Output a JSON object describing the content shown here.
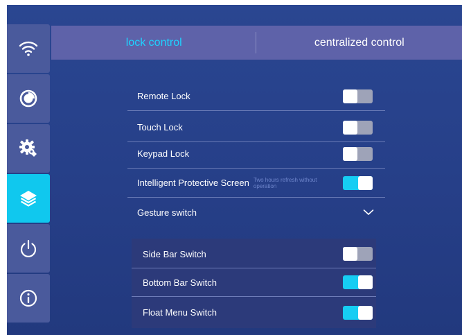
{
  "sidebar": {
    "items": [
      {
        "icon": "wifi-icon",
        "active": false
      },
      {
        "icon": "clock-icon",
        "active": false
      },
      {
        "icon": "gear-icon",
        "active": false
      },
      {
        "icon": "layers-icon",
        "active": true
      },
      {
        "icon": "power-icon",
        "active": false
      },
      {
        "icon": "info-icon",
        "active": false
      }
    ]
  },
  "tabs": [
    {
      "label": "lock control",
      "active": true
    },
    {
      "label": "centralized control",
      "active": false
    }
  ],
  "settings": {
    "remote_lock": {
      "label": "Remote Lock",
      "on": false
    },
    "touch_lock": {
      "label": "Touch Lock",
      "on": false
    },
    "keypad_lock": {
      "label": "Keypad Lock",
      "on": false
    },
    "protective_screen": {
      "label": "Intelligent Protective Screen",
      "note": "Two hours refresh without operation",
      "on": true
    },
    "gesture_switch": {
      "label": "Gesture switch",
      "expanded": true
    }
  },
  "gesture": {
    "side_bar": {
      "label": "Side Bar Switch",
      "on": false
    },
    "bottom_bar": {
      "label": "Bottom Bar Switch",
      "on": true
    },
    "float_menu": {
      "label": "Float Menu Switch",
      "on": true
    }
  },
  "colors": {
    "accent": "#16cdf3",
    "background": "#263f88",
    "tab_bar": "#5e62a9",
    "sidebar_item": "#4a5a9c",
    "toggle_off": "#9ea3b8"
  }
}
